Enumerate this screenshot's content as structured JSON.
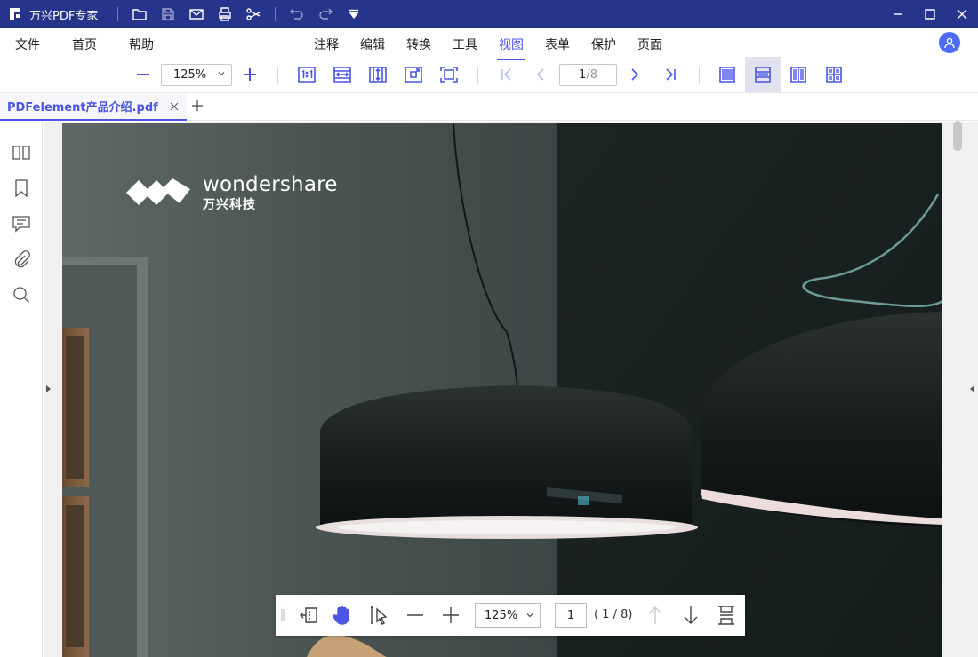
{
  "app": {
    "title": "万兴PDF专家"
  },
  "menu": {
    "items": [
      {
        "label": "文件"
      },
      {
        "label": "首页"
      },
      {
        "label": "帮助"
      },
      {
        "label": "注释"
      },
      {
        "label": "编辑"
      },
      {
        "label": "转换"
      },
      {
        "label": "工具"
      },
      {
        "label": "视图",
        "active": true
      },
      {
        "label": "表单"
      },
      {
        "label": "保护"
      },
      {
        "label": "页面"
      }
    ]
  },
  "toolbar": {
    "zoom_value": "125%",
    "page_current": "1",
    "page_total": "/8",
    "accent_color": "#4a55e3"
  },
  "tabs": {
    "document": "PDFelement产品介绍.pdf"
  },
  "document": {
    "brand_name": "wondershare",
    "brand_sub": "万兴科技"
  },
  "floatbar": {
    "zoom_value": "125%",
    "page_value": "1",
    "page_total": "( 1 / 8)"
  },
  "colors": {
    "titlebar": "#27348b",
    "accent": "#4a55e3"
  }
}
